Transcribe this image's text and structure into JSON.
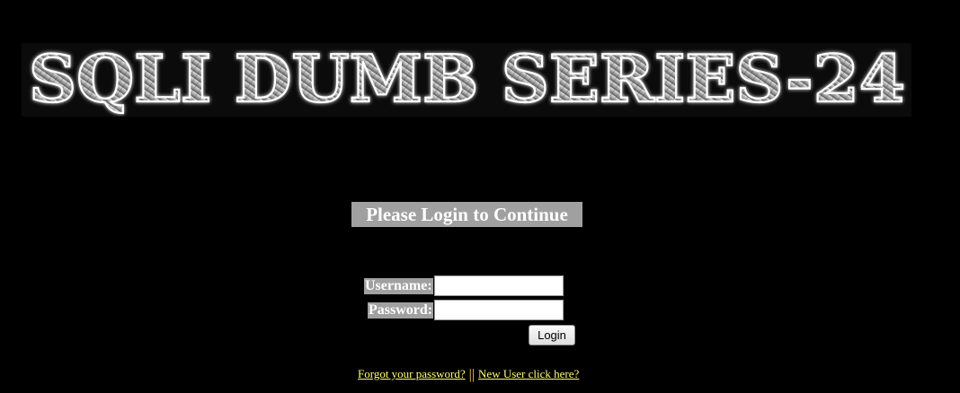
{
  "banner": {
    "title": "SQLI DUMB SERIES-24"
  },
  "heading": "Please Login to Continue",
  "form": {
    "username_label": "Username:",
    "password_label": "Password:",
    "username_value": "",
    "password_value": "",
    "login_label": "Login"
  },
  "links": {
    "forgot_password": "Forgot your password?",
    "separator": "||",
    "new_user": "New User click here?"
  },
  "colors": {
    "background": "#000000",
    "label_background": "#a0a0a0",
    "link": "#ffff66",
    "separator": "#ffcc33"
  }
}
